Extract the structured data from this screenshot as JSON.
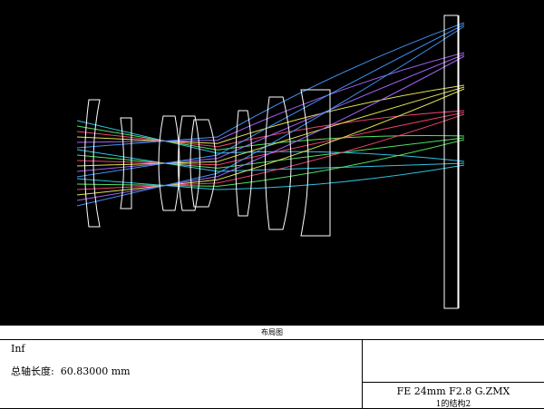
{
  "footer": {
    "title": "布局图",
    "object_distance": "Inf",
    "total_axial_length_label": "总轴长度:",
    "total_axial_length_value": "60.83000 mm",
    "file_name": "FE 24mm F2.8 G.ZMX",
    "config_label": "1的结构2"
  },
  "colors": {
    "background": "#000000",
    "lens_outline": "#ffffff",
    "ray_field_1": "#33ccee",
    "ray_field_2": "#55ee66",
    "ray_field_3": "#ff4477",
    "ray_field_4": "#eeee55",
    "ray_field_5": "#aa66ff",
    "ray_field_6": "#4499ff"
  }
}
